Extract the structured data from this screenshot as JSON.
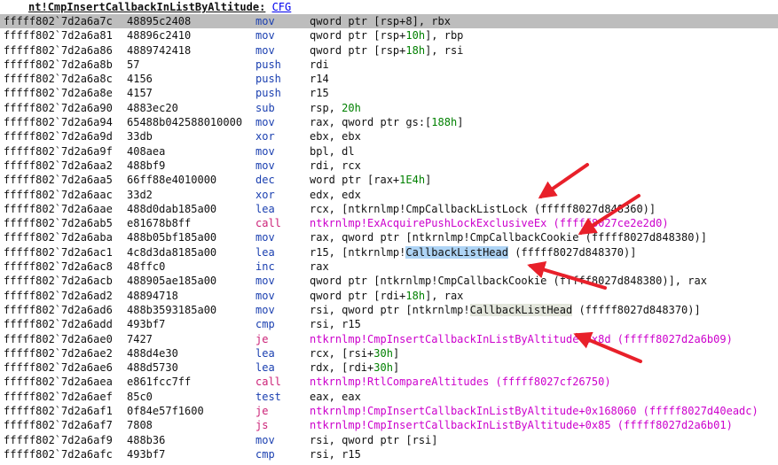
{
  "header": {
    "prefix": "nt!",
    "function": "CmpInsertCallbackInListByAltitude",
    "colon": ":",
    "cfg_link": "CFG"
  },
  "lines": [
    {
      "addr": "fffff802`7d2a6a7c",
      "bytes": "48895c2408",
      "mnemonic": "mov",
      "ops": [
        {
          "t": "qword ptr [rsp+8], rbx"
        }
      ],
      "current": true
    },
    {
      "addr": "fffff802`7d2a6a81",
      "bytes": "48896c2410",
      "mnemonic": "mov",
      "ops": [
        {
          "t": "qword ptr [rsp+"
        },
        {
          "t": "10h",
          "c": "num"
        },
        {
          "t": "], rbp"
        }
      ]
    },
    {
      "addr": "fffff802`7d2a6a86",
      "bytes": "4889742418",
      "mnemonic": "mov",
      "ops": [
        {
          "t": "qword ptr [rsp+"
        },
        {
          "t": "18h",
          "c": "num"
        },
        {
          "t": "], rsi"
        }
      ]
    },
    {
      "addr": "fffff802`7d2a6a8b",
      "bytes": "57",
      "mnemonic": "push",
      "ops": [
        {
          "t": "rdi"
        }
      ]
    },
    {
      "addr": "fffff802`7d2a6a8c",
      "bytes": "4156",
      "mnemonic": "push",
      "ops": [
        {
          "t": "r14"
        }
      ]
    },
    {
      "addr": "fffff802`7d2a6a8e",
      "bytes": "4157",
      "mnemonic": "push",
      "ops": [
        {
          "t": "r15"
        }
      ]
    },
    {
      "addr": "fffff802`7d2a6a90",
      "bytes": "4883ec20",
      "mnemonic": "sub",
      "ops": [
        {
          "t": "rsp, "
        },
        {
          "t": "20h",
          "c": "num"
        }
      ]
    },
    {
      "addr": "fffff802`7d2a6a94",
      "bytes": "65488b042588010000",
      "mnemonic": "mov",
      "ops": [
        {
          "t": "rax, qword ptr gs:["
        },
        {
          "t": "188h",
          "c": "num"
        },
        {
          "t": "]"
        }
      ]
    },
    {
      "addr": "fffff802`7d2a6a9d",
      "bytes": "33db",
      "mnemonic": "xor",
      "ops": [
        {
          "t": "ebx, ebx"
        }
      ]
    },
    {
      "addr": "fffff802`7d2a6a9f",
      "bytes": "408aea",
      "mnemonic": "mov",
      "ops": [
        {
          "t": "bpl, dl"
        }
      ]
    },
    {
      "addr": "fffff802`7d2a6aa2",
      "bytes": "488bf9",
      "mnemonic": "mov",
      "ops": [
        {
          "t": "rdi, rcx"
        }
      ]
    },
    {
      "addr": "fffff802`7d2a6aa5",
      "bytes": "66ff88e4010000",
      "mnemonic": "dec",
      "ops": [
        {
          "t": "word ptr [rax+"
        },
        {
          "t": "1E4h",
          "c": "num"
        },
        {
          "t": "]"
        }
      ]
    },
    {
      "addr": "fffff802`7d2a6aac",
      "bytes": "33d2",
      "mnemonic": "xor",
      "ops": [
        {
          "t": "edx, edx"
        }
      ]
    },
    {
      "addr": "fffff802`7d2a6aae",
      "bytes": "488d0dab185a00",
      "mnemonic": "lea",
      "ops": [
        {
          "t": "rcx, [ntkrnlmp!CmpCallbackListLock (fffff8027d848360)]"
        }
      ]
    },
    {
      "addr": "fffff802`7d2a6ab5",
      "bytes": "e81678b8ff",
      "mnemonic": "call",
      "mclass": "call-red",
      "oclass": "magenta",
      "ops": [
        {
          "t": "ntkrnlmp!ExAcquirePushLockExclusiveEx (fffff8027ce2e2d0)"
        }
      ]
    },
    {
      "addr": "fffff802`7d2a6aba",
      "bytes": "488b05bf185a00",
      "mnemonic": "mov",
      "ops": [
        {
          "t": "rax, qword ptr [ntkrnlmp!CmpCallbackCookie (fffff8027d848380)]"
        }
      ]
    },
    {
      "addr": "fffff802`7d2a6ac1",
      "bytes": "4c8d3da8185a00",
      "mnemonic": "lea",
      "ops": [
        {
          "t": "r15, [ntkrnlmp!"
        },
        {
          "t": "CallbackListHead",
          "c": "hl-blue"
        },
        {
          "t": " (fffff8027d848370)]"
        }
      ]
    },
    {
      "addr": "fffff802`7d2a6ac8",
      "bytes": "48ffc0",
      "mnemonic": "inc",
      "ops": [
        {
          "t": "rax"
        }
      ]
    },
    {
      "addr": "fffff802`7d2a6acb",
      "bytes": "488905ae185a00",
      "mnemonic": "mov",
      "ops": [
        {
          "t": "qword ptr [ntkrnlmp!CmpCallbackCookie (fffff8027d848380)], rax"
        }
      ]
    },
    {
      "addr": "fffff802`7d2a6ad2",
      "bytes": "48894718",
      "mnemonic": "mov",
      "ops": [
        {
          "t": "qword ptr [rdi+"
        },
        {
          "t": "18h",
          "c": "num"
        },
        {
          "t": "], rax"
        }
      ]
    },
    {
      "addr": "fffff802`7d2a6ad6",
      "bytes": "488b3593185a00",
      "mnemonic": "mov",
      "ops": [
        {
          "t": "rsi, qword ptr [ntkrnlmp!"
        },
        {
          "t": "CallbackListHead",
          "c": "hl-grey"
        },
        {
          "t": " (fffff8027d848370)]"
        }
      ]
    },
    {
      "addr": "fffff802`7d2a6add",
      "bytes": "493bf7",
      "mnemonic": "cmp",
      "ops": [
        {
          "t": "rsi, r15"
        }
      ]
    },
    {
      "addr": "fffff802`7d2a6ae0",
      "bytes": "7427",
      "mnemonic": "je",
      "mclass": "call-red",
      "oclass": "magenta",
      "ops": [
        {
          "t": "ntkrnlmp!CmpInsertCallbackInListByAltitude+0x8d (fffff8027d2a6b09)"
        }
      ]
    },
    {
      "addr": "fffff802`7d2a6ae2",
      "bytes": "488d4e30",
      "mnemonic": "lea",
      "ops": [
        {
          "t": "rcx, [rsi+"
        },
        {
          "t": "30h",
          "c": "num"
        },
        {
          "t": "]"
        }
      ]
    },
    {
      "addr": "fffff802`7d2a6ae6",
      "bytes": "488d5730",
      "mnemonic": "lea",
      "ops": [
        {
          "t": "rdx, [rdi+"
        },
        {
          "t": "30h",
          "c": "num"
        },
        {
          "t": "]"
        }
      ]
    },
    {
      "addr": "fffff802`7d2a6aea",
      "bytes": "e861fcc7ff",
      "mnemonic": "call",
      "mclass": "call-red",
      "oclass": "magenta",
      "ops": [
        {
          "t": "ntkrnlmp!RtlCompareAltitudes (fffff8027cf26750)"
        }
      ]
    },
    {
      "addr": "fffff802`7d2a6aef",
      "bytes": "85c0",
      "mnemonic": "test",
      "ops": [
        {
          "t": "eax, eax"
        }
      ]
    },
    {
      "addr": "fffff802`7d2a6af1",
      "bytes": "0f84e57f1600",
      "mnemonic": "je",
      "mclass": "call-red",
      "oclass": "magenta",
      "ops": [
        {
          "t": "ntkrnlmp!CmpInsertCallbackInListByAltitude+0x168060 (fffff8027d40eadc)"
        }
      ]
    },
    {
      "addr": "fffff802`7d2a6af7",
      "bytes": "7808",
      "mnemonic": "js",
      "mclass": "call-red",
      "oclass": "magenta",
      "ops": [
        {
          "t": "ntkrnlmp!CmpInsertCallbackInListByAltitude+0x85 (fffff8027d2a6b01)"
        }
      ]
    },
    {
      "addr": "fffff802`7d2a6af9",
      "bytes": "488b36",
      "mnemonic": "mov",
      "ops": [
        {
          "t": "rsi, qword ptr [rsi]"
        }
      ]
    },
    {
      "addr": "fffff802`7d2a6afc",
      "bytes": "493bf7",
      "mnemonic": "cmp",
      "ops": [
        {
          "t": "rsi, r15"
        }
      ]
    }
  ],
  "colors": {
    "mnemonic": "#1a3fb0",
    "branch": "#cc2277",
    "symbol_target": "#cc00cc",
    "immediate": "#008000",
    "highlight_blue": "#aed4f5",
    "highlight_grey": "#e3e6dc",
    "current_line": "#bdbdbd",
    "arrow": "#e8202a"
  },
  "annotations": {
    "arrow_count": 4,
    "arrow_icon": "red-arrow-icon"
  }
}
